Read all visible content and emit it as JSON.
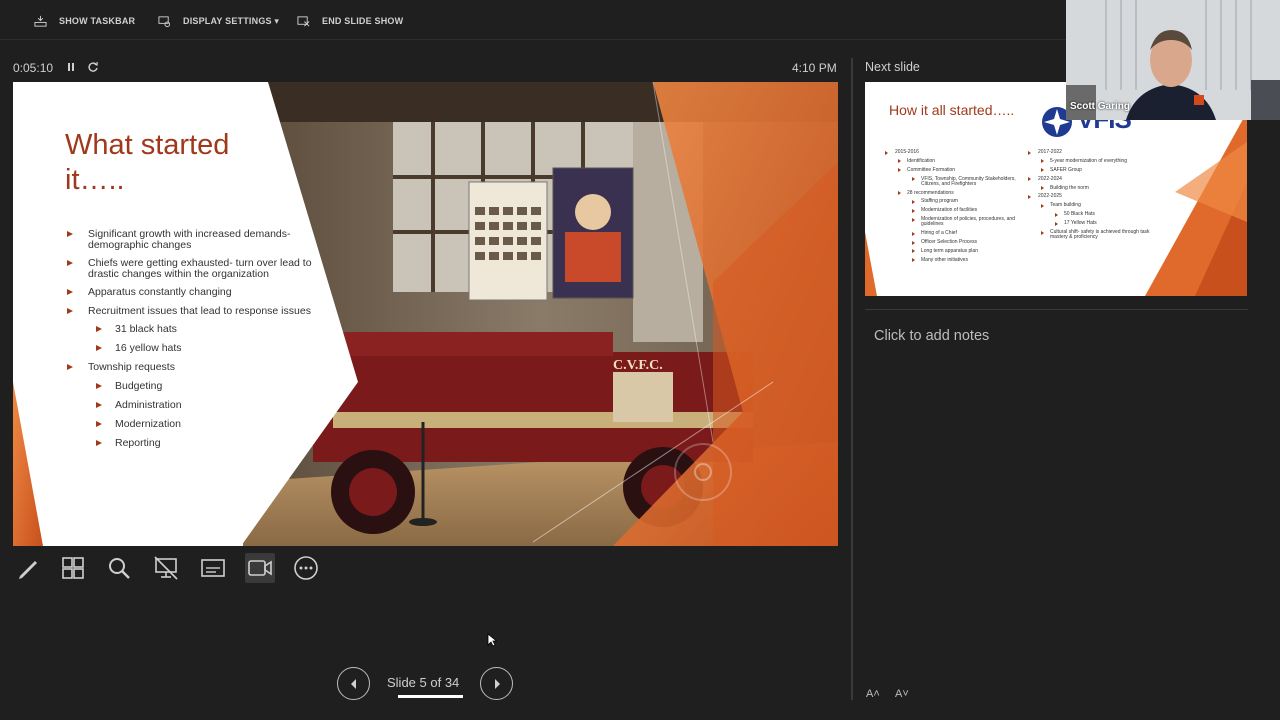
{
  "toolbar": {
    "show_taskbar": "SHOW TASKBAR",
    "display_settings": "DISPLAY SETTINGS ▾",
    "end_slide_show": "END SLIDE SHOW"
  },
  "timer": {
    "elapsed": "0:05:10",
    "clock": "4:10 PM"
  },
  "current_slide": {
    "title": "What started it…..",
    "bullets": [
      {
        "text": "Significant growth with increased demands- demographic changes",
        "level": 1
      },
      {
        "text": "Chiefs were getting exhausted- turn over lead to drastic changes within the organization",
        "level": 1
      },
      {
        "text": "Apparatus constantly changing",
        "level": 1
      },
      {
        "text": "Recruitment issues that lead to response issues",
        "level": 1
      },
      {
        "text": "31 black hats",
        "level": 2
      },
      {
        "text": "16 yellow hats",
        "level": 2
      },
      {
        "text": "Township requests",
        "level": 1
      },
      {
        "text": "Budgeting",
        "level": 2
      },
      {
        "text": "Administration",
        "level": 2
      },
      {
        "text": "Modernization",
        "level": 2
      },
      {
        "text": "Reporting",
        "level": 2
      }
    ],
    "photo_truck_lettering": "C.V.F.C.",
    "accent_color": "#a0381c",
    "orange_color": "#e06a2c"
  },
  "tools": [
    "pen-icon",
    "see-all-slides-icon",
    "zoom-icon",
    "black-screen-icon",
    "subtitles-icon",
    "camera-icon",
    "more-options-icon"
  ],
  "navigation": {
    "counter": "Slide 5 of 34",
    "current": 5,
    "total": 34
  },
  "next_slide": {
    "label": "Next slide",
    "title": "How it all started…..",
    "logo": "VFIS",
    "left_column": [
      {
        "text": "2015-2016",
        "level": 1
      },
      {
        "text": "Identification",
        "level": 2
      },
      {
        "text": "Committee Formation",
        "level": 2
      },
      {
        "text": "VFIS, Township, Community Stakeholders, Citizens, and Firefighters",
        "level": 3
      },
      {
        "text": "28 recommendations",
        "level": 2
      },
      {
        "text": "Staffing program",
        "level": 3
      },
      {
        "text": "Modernization of facilities",
        "level": 3
      },
      {
        "text": "Modernization of policies, procedures, and guidelines",
        "level": 3
      },
      {
        "text": "Hiring of a Chief",
        "level": 3
      },
      {
        "text": "Officer Selection Process",
        "level": 3
      },
      {
        "text": "Long term apparatus plan",
        "level": 3
      },
      {
        "text": "Many other initiatives",
        "level": 3
      }
    ],
    "right_column": [
      {
        "text": "2017-2022",
        "level": 1
      },
      {
        "text": "5-year modernization of everything",
        "level": 2
      },
      {
        "text": "SAFER Group",
        "level": 2
      },
      {
        "text": "2022-2024",
        "level": 1
      },
      {
        "text": "Building the norm",
        "level": 2
      },
      {
        "text": "2022-2025",
        "level": 1
      },
      {
        "text": "Team building",
        "level": 2
      },
      {
        "text": "50 Black Hats",
        "level": 3
      },
      {
        "text": "17 Yellow Hats",
        "level": 3
      },
      {
        "text": "Cultural shift- safety is achieved through task mastery & proficiency",
        "level": 2
      }
    ]
  },
  "notes": {
    "placeholder": "Click to add notes"
  },
  "font_controls": {
    "increase": "A˄",
    "decrease": "A˅"
  },
  "webcam": {
    "participant_name": "Scott Garing"
  }
}
